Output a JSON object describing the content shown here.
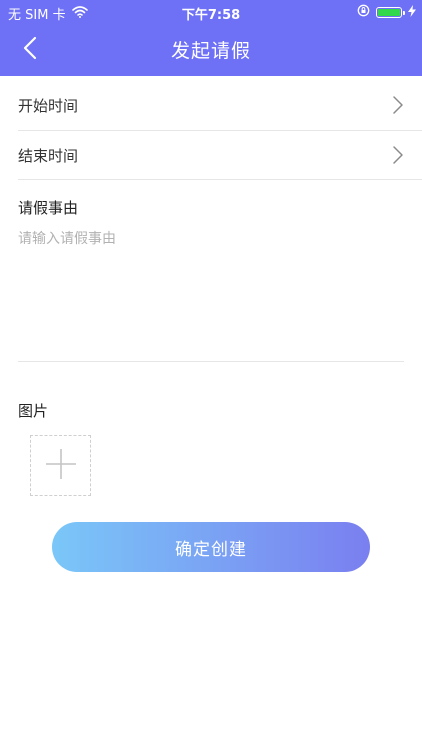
{
  "status_bar": {
    "carrier": "无 SIM 卡",
    "time": "下午7:58",
    "icons": [
      "wifi-icon",
      "rotation-lock-icon",
      "battery-icon",
      "charging-icon"
    ]
  },
  "nav": {
    "title": "发起请假",
    "back_icon": "chevron-left-icon"
  },
  "form": {
    "start_time_label": "开始时间",
    "end_time_label": "结束时间",
    "reason_label": "请假事由",
    "reason_value": "",
    "reason_placeholder": "请输入请假事由",
    "photo_label": "图片",
    "add_photo_icon": "plus-icon",
    "submit_label": "确定创建"
  },
  "colors": {
    "header_bg": "#6e71f6",
    "button_gradient_start": "#7ac7f8",
    "button_gradient_end": "#7a7ff0",
    "battery_fill": "#32d74b"
  }
}
